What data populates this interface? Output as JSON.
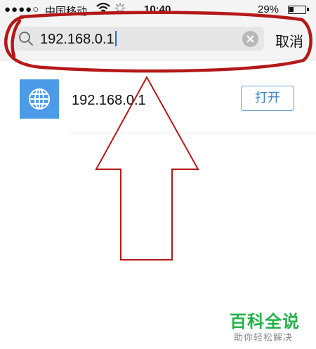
{
  "status_bar": {
    "signal_dots": "●●●●○",
    "carrier": "中国移动",
    "time": "10:40",
    "battery_percent": "29%",
    "battery_level": 0.29
  },
  "search": {
    "query": "192.168.0.1",
    "cancel_label": "取消"
  },
  "results": [
    {
      "title": "192.168.0.1",
      "action_label": "打开",
      "icon": "globe-icon"
    }
  ],
  "annotations": {
    "color": "#b51818",
    "shapes": [
      "ellipse-around-search-bar",
      "up-arrow-pointing-to-result"
    ]
  },
  "watermark": {
    "title": "百科全说",
    "subtitle": "助你轻松解决",
    "color": "#22b14c"
  },
  "colors": {
    "accent_blue": "#3b7fc2",
    "globe_blue": "#4c9be8"
  }
}
